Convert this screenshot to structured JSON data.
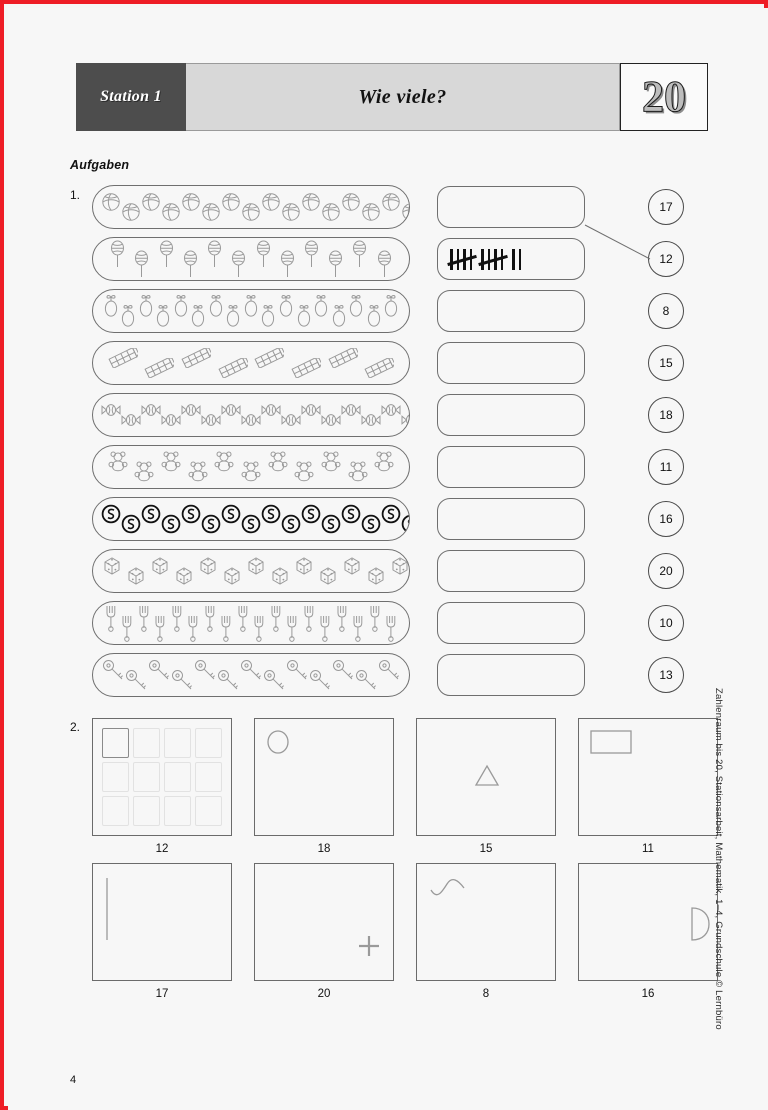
{
  "header": {
    "station_label": "Station 1",
    "title": "Wie viele?",
    "number_range": "20"
  },
  "section_heading": "Aufgaben",
  "exercise1": {
    "number": "1.",
    "rows": [
      {
        "icon": "ball-icon",
        "count": 17,
        "answer_value": ""
      },
      {
        "icon": "lollipop-icon",
        "count": 12,
        "answer_value": "tally-12"
      },
      {
        "icon": "pear-icon",
        "count": 17,
        "answer_value": ""
      },
      {
        "icon": "chocolate-bar-icon",
        "count": 8,
        "answer_value": ""
      },
      {
        "icon": "wrapped-candy-icon",
        "count": 20,
        "answer_value": ""
      },
      {
        "icon": "gummy-bear-icon",
        "count": 11,
        "answer_value": ""
      },
      {
        "icon": "coin-icon",
        "count": 16,
        "answer_value": ""
      },
      {
        "icon": "dice-icon",
        "count": 15,
        "answer_value": ""
      },
      {
        "icon": "fork-icon",
        "count": 18,
        "answer_value": ""
      },
      {
        "icon": "key-icon",
        "count": 13,
        "answer_value": ""
      }
    ],
    "tally": {
      "groups_of_five": 2,
      "singles": 2,
      "total": "12"
    },
    "circles": [
      "17",
      "12",
      "8",
      "15",
      "18",
      "11",
      "16",
      "20",
      "10",
      "13"
    ],
    "connector": {
      "from": "answer-box-1",
      "to": "circle-12"
    }
  },
  "exercise2": {
    "number": "2.",
    "boxes": [
      {
        "shape": "square-icon",
        "caption": "12"
      },
      {
        "shape": "circle-icon",
        "caption": "18"
      },
      {
        "shape": "triangle-icon",
        "caption": "15"
      },
      {
        "shape": "rectangle-icon",
        "caption": "11"
      },
      {
        "shape": "vertical-line-icon",
        "caption": "17"
      },
      {
        "shape": "plus-icon",
        "caption": "20"
      },
      {
        "shape": "wave-icon",
        "caption": "8"
      },
      {
        "shape": "half-circle-icon",
        "caption": "16"
      }
    ]
  },
  "credit": "Zahlenraum bis 20, Stationsarbeit, Mathematik, 1–4, Grundschule © Lernbüro",
  "page_number": "4",
  "colors": {
    "frame": "#ee1c25",
    "station_bg": "#4d4d4d",
    "title_bg": "#d8d8d8",
    "outline": "#6f6f6f"
  }
}
